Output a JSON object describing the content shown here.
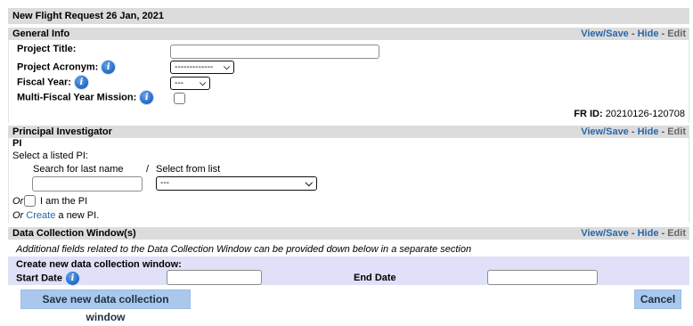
{
  "title": "New Flight Request 26 Jan, 2021",
  "section_links": {
    "view_save": "View/Save",
    "hide": "Hide",
    "edit": "Edit",
    "sep": " - "
  },
  "general": {
    "heading": "General Info",
    "project_title_label": "Project Title:",
    "project_title_value": "",
    "project_acronym_label": "Project Acronym:",
    "project_acronym_value": "-------------",
    "fiscal_year_label": "Fiscal Year:",
    "fiscal_year_value": "---",
    "multi_fiscal_label": "Multi-Fiscal Year Mission:",
    "fr_id_label": "FR ID:",
    "fr_id_value": "20210126-120708"
  },
  "pi": {
    "heading": "Principal Investigator",
    "subheading": "PI",
    "select_listed": "Select a listed PI:",
    "search_label": "Search for last name",
    "slash": "/",
    "select_from_list_label": "Select from list",
    "select_value": "---",
    "or1": "Or",
    "i_am_pi": "I am the PI",
    "or2": "Or",
    "create_link": "Create",
    "create_rest": "a new PI."
  },
  "dcw": {
    "heading": "Data Collection Window(s)",
    "note": "Additional fields related to the Data Collection Window can be provided down below in a separate section",
    "create_label": "Create new data collection window:",
    "start_label": "Start Date",
    "end_label": "End Date",
    "save_button": "Save new data collection window",
    "cancel_button": "Cancel"
  },
  "icons": {
    "info": "info-icon",
    "chevron": "chevron-down-icon"
  },
  "colors": {
    "link": "#2a66a8",
    "header_bg": "#dcdcdc",
    "form_bg": "#e0e0f8",
    "button_bg": "#a9c8ec"
  }
}
